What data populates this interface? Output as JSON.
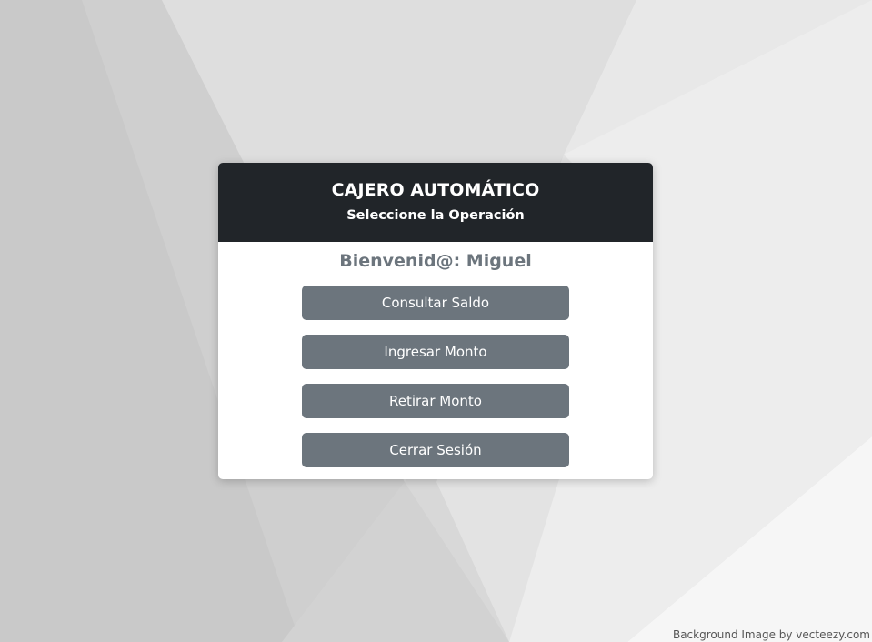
{
  "app": {
    "title": "CAJERO AUTOMÁTICO",
    "subtitle": "Seleccione la Operación"
  },
  "welcome": {
    "text": "Bienvenid@: Miguel"
  },
  "actions": {
    "check_balance": "Consultar Saldo",
    "deposit": "Ingresar Monto",
    "withdraw": "Retirar Monto",
    "logout": "Cerrar Sesión"
  },
  "footer": {
    "credit": "Background Image by vecteezy.com"
  },
  "colors": {
    "header_bg": "#212529",
    "button_bg": "#6c757d",
    "welcome_text": "#6c757d"
  }
}
